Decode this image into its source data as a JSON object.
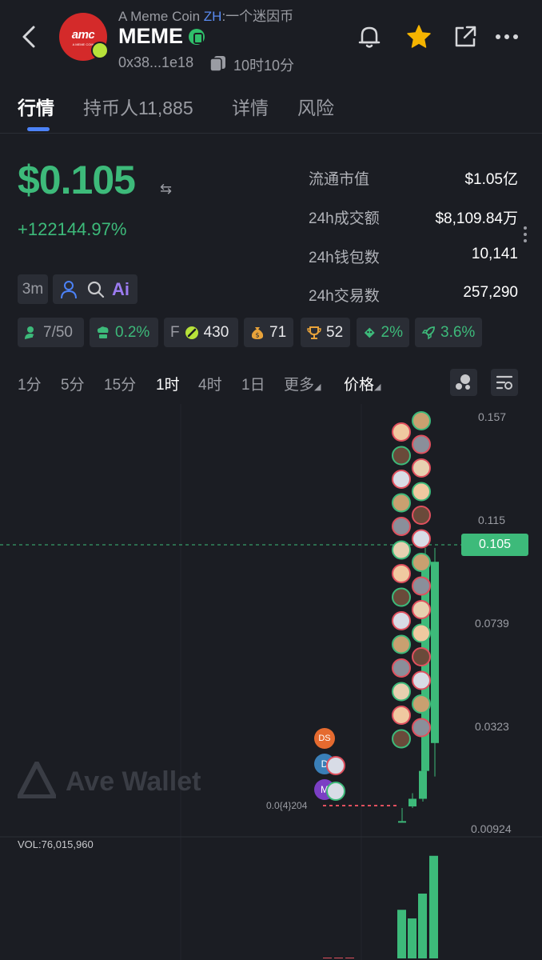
{
  "header": {
    "subtitle_en": "A Meme Coin",
    "subtitle_zh_tag": "ZH",
    "subtitle_zh": ":一个迷因币",
    "token_name": "MEME",
    "address": "0x38...1e18",
    "age": "10时10分",
    "logo_text": "amc",
    "logo_sub": "A MEME COIN",
    "icons": [
      "back-arrow",
      "bell",
      "star",
      "share",
      "more"
    ]
  },
  "tabs": [
    {
      "label": "行情",
      "active": true
    },
    {
      "label": "持币人11,885",
      "active": false
    },
    {
      "label": "详情",
      "active": false
    },
    {
      "label": "风险",
      "active": false
    }
  ],
  "price": {
    "value": "$0.105",
    "change": "+122144.97%"
  },
  "stats": [
    {
      "label": "流通市值",
      "value": "$1.05亿"
    },
    {
      "label": "24h成交额",
      "value": "$8,109.84万"
    },
    {
      "label": "24h钱包数",
      "value": "10,141"
    },
    {
      "label": "24h交易数",
      "value": "257,290"
    }
  ],
  "tools": {
    "interval": "3m",
    "ai": "Ai"
  },
  "chips": [
    {
      "icon": "user-icon",
      "value": "7/50"
    },
    {
      "icon": "chef-icon",
      "value": "0.2%"
    },
    {
      "prefix": "F",
      "icon": "pump-icon",
      "value": "430"
    },
    {
      "icon": "moneybag-icon",
      "value": "71"
    },
    {
      "icon": "trophy-icon",
      "value": "52"
    },
    {
      "icon": "bundle-icon",
      "value": "2%"
    },
    {
      "icon": "rocket-icon",
      "value": "3.6%"
    }
  ],
  "timeframes": [
    {
      "label": "1分",
      "active": false
    },
    {
      "label": "5分",
      "active": false
    },
    {
      "label": "15分",
      "active": false
    },
    {
      "label": "1时",
      "active": true
    },
    {
      "label": "4时",
      "active": false
    },
    {
      "label": "1日",
      "active": false
    },
    {
      "label": "更多",
      "active": false
    },
    {
      "label": "价格",
      "active": true
    }
  ],
  "chart": {
    "y_labels": [
      "0.157",
      "0.115",
      "0.0739",
      "0.0323",
      "0.00924"
    ],
    "current_price": "0.105",
    "low_label": "0.0{4}204",
    "volume_label": "VOL:76,015,960",
    "watermark": "Ave Wallet",
    "markers": [
      "DS",
      "D",
      "M"
    ],
    "colors": {
      "up": "#3dba7a",
      "down": "#e0505e",
      "bg": "#1b1d23"
    }
  },
  "chart_data": {
    "type": "candlestick",
    "ylim": [
      0.00924,
      0.157
    ],
    "current_price": 0.105,
    "candles": [
      {
        "open": 0.0001,
        "high": 0.012,
        "low": 0.0001,
        "close": 0.012
      },
      {
        "open": 0.012,
        "high": 0.022,
        "low": 0.011,
        "close": 0.02
      },
      {
        "open": 0.02,
        "high": 0.03,
        "low": 0.019,
        "close": 0.03
      },
      {
        "open": 0.03,
        "high": 0.11,
        "low": 0.029,
        "close": 0.106
      },
      {
        "open": 0.04,
        "high": 0.11,
        "low": 0.028,
        "close": 0.105
      }
    ],
    "volumes": [
      0,
      0,
      0,
      0.45,
      0.37,
      0.6,
      0.95
    ]
  }
}
